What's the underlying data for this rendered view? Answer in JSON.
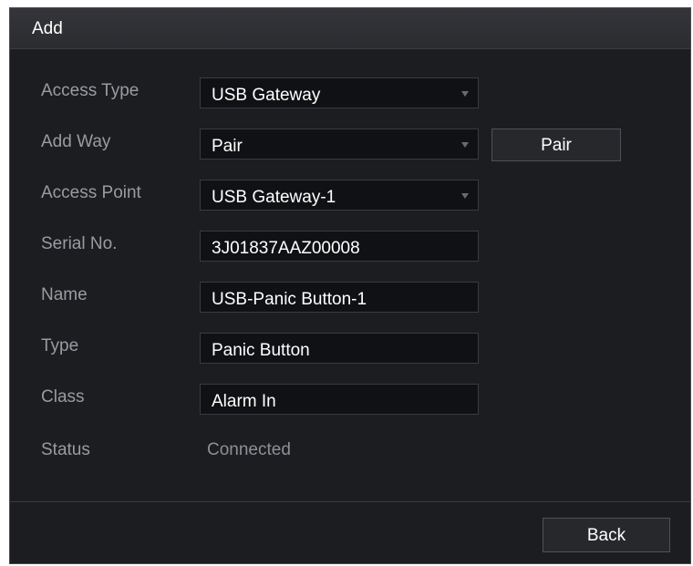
{
  "dialog": {
    "title": "Add"
  },
  "form": {
    "access_type": {
      "label": "Access Type",
      "value": "USB Gateway"
    },
    "add_way": {
      "label": "Add Way",
      "value": "Pair",
      "button": "Pair"
    },
    "access_point": {
      "label": "Access Point",
      "value": "USB Gateway-1"
    },
    "serial_no": {
      "label": "Serial No.",
      "value": "3J01837AAZ00008"
    },
    "name": {
      "label": "Name",
      "value": "USB-Panic Button-1"
    },
    "type": {
      "label": "Type",
      "value": "Panic Button"
    },
    "class": {
      "label": "Class",
      "value": "Alarm In"
    },
    "status": {
      "label": "Status",
      "value": "Connected"
    }
  },
  "footer": {
    "back_label": "Back"
  },
  "icons": {
    "dropdown": "chevron-down-icon"
  },
  "colors": {
    "background": "#1c1d21",
    "titlebar": "#2f3034",
    "field": "#101114",
    "label_text": "#9a9ba0"
  }
}
